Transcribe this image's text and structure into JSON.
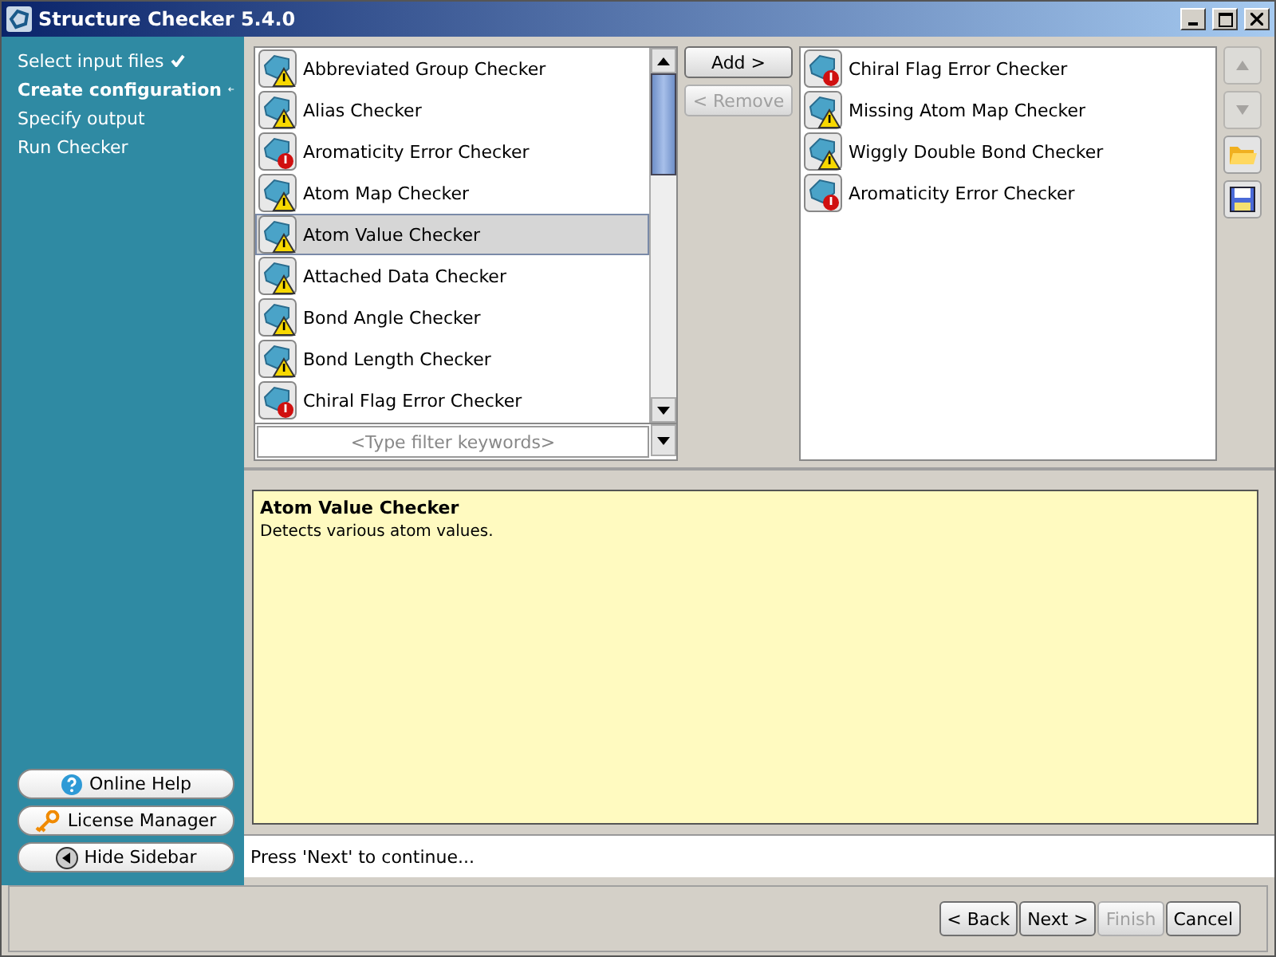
{
  "window": {
    "title": "Structure Checker 5.4.0"
  },
  "steps": [
    {
      "label": "Select input files",
      "done": true,
      "selected": false
    },
    {
      "label": "Create configuration",
      "done": false,
      "selected": true
    },
    {
      "label": "Specify output",
      "done": false,
      "selected": false
    },
    {
      "label": "Run Checker",
      "done": false,
      "selected": false
    }
  ],
  "sidebar_buttons": [
    {
      "label": "Online Help",
      "kind": "help"
    },
    {
      "label": "License Manager",
      "kind": "key"
    },
    {
      "label": "Hide Sidebar",
      "kind": "hide"
    }
  ],
  "available": {
    "items": [
      {
        "label": "Abbreviated Group Checker",
        "kind": "warning",
        "selected": false
      },
      {
        "label": "Alias Checker",
        "kind": "warning",
        "selected": false
      },
      {
        "label": "Aromaticity Error Checker",
        "kind": "error",
        "selected": false
      },
      {
        "label": "Atom Map Checker",
        "kind": "warning",
        "selected": false
      },
      {
        "label": "Atom Value Checker",
        "kind": "warning",
        "selected": true
      },
      {
        "label": "Attached Data Checker",
        "kind": "warning",
        "selected": false
      },
      {
        "label": "Bond Angle Checker",
        "kind": "warning",
        "selected": false
      },
      {
        "label": "Bond Length Checker",
        "kind": "warning",
        "selected": false
      },
      {
        "label": "Chiral Flag Error Checker",
        "kind": "error",
        "selected": false
      }
    ],
    "filter": {
      "placeholder": "<Type filter keywords>"
    }
  },
  "transfer_buttons": [
    {
      "label": "Add >",
      "disabled": false
    },
    {
      "label": "< Remove",
      "disabled": true
    }
  ],
  "configured": {
    "items": [
      {
        "label": "Chiral Flag Error Checker",
        "kind": "error",
        "selected": false
      },
      {
        "label": "Missing Atom Map Checker",
        "kind": "warning",
        "selected": false
      },
      {
        "label": "Wiggly Double Bond Checker",
        "kind": "warning",
        "selected": false
      },
      {
        "label": "Aromaticity Error Checker",
        "kind": "error",
        "selected": false
      }
    ]
  },
  "side_tools": [
    {
      "kind": "up",
      "disabled": true
    },
    {
      "kind": "down",
      "disabled": true
    },
    {
      "kind": "open",
      "disabled": false
    },
    {
      "kind": "save",
      "disabled": false
    }
  ],
  "description": {
    "title": "Atom Value Checker",
    "text": "Detects various atom values."
  },
  "status_bar": "Press 'Next' to continue...",
  "footer_buttons": [
    {
      "label": "< Back",
      "disabled": false
    },
    {
      "label": "Next >",
      "disabled": false
    },
    {
      "label": "Finish",
      "disabled": true
    },
    {
      "label": "Cancel",
      "disabled": false
    }
  ]
}
